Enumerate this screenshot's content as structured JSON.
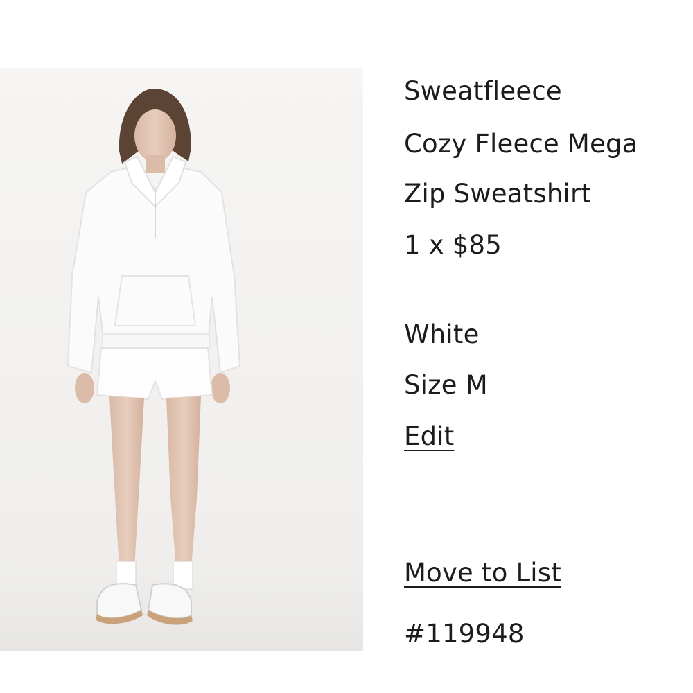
{
  "product": {
    "image_alt": "Model wearing white Cozy Fleece Mega Zip Sweatshirt with white shorts",
    "brand": "Sweatfleece",
    "name_line1": "Cozy Fleece Mega",
    "name_line2": "Zip Sweatshirt",
    "quantity_price": "1 x $85",
    "color": "White",
    "size": "Size M",
    "edit_label": "Edit",
    "move_to_list_label": "Move to List",
    "sku": "#119948"
  }
}
